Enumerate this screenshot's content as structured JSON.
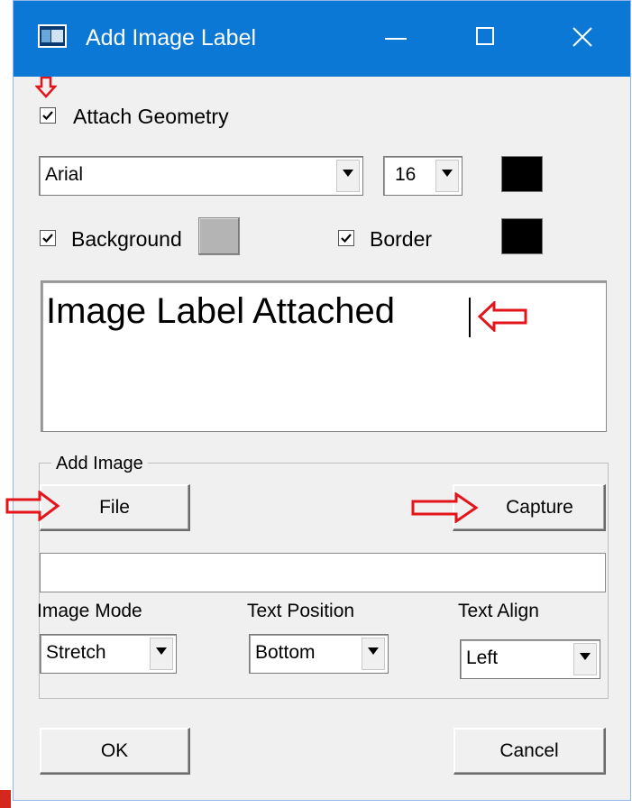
{
  "window": {
    "title": "Add Image Label",
    "icons": [
      "app-window-icon",
      "minimize-icon",
      "maximize-icon",
      "close-icon"
    ]
  },
  "attach_geometry": {
    "label": "Attach Geometry",
    "checked": true
  },
  "font": {
    "family": "Arial",
    "size": "16",
    "color": "#000000"
  },
  "background": {
    "label": "Background",
    "checked": true,
    "color": "#b4b4b4"
  },
  "border": {
    "label": "Border",
    "checked": true,
    "color": "#000000"
  },
  "label_text": "Image Label Attached ",
  "add_image": {
    "group_title": "Add Image",
    "file_button": "File",
    "capture_button": "Capture",
    "path_value": ""
  },
  "image_mode": {
    "label": "Image Mode",
    "value": "Stretch"
  },
  "text_position": {
    "label": "Text Position",
    "value": "Bottom"
  },
  "text_align": {
    "label": "Text Align",
    "value": "Left"
  },
  "ok_button": "OK",
  "cancel_button": "Cancel",
  "colors": {
    "titlebar": "#0a78d4",
    "annotation": "#e3141a",
    "dialog_bg": "#f0f0f0"
  }
}
